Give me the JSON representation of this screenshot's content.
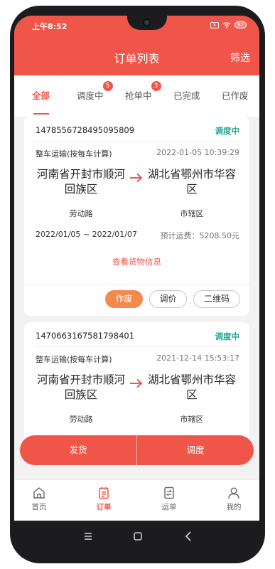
{
  "statusbar": {
    "time": "上午8:52",
    "battery": "97"
  },
  "header": {
    "title": "订单列表",
    "filter_label": "筛选"
  },
  "tabs": [
    {
      "label": "全部",
      "active": true
    },
    {
      "label": "调度中",
      "badge": "5"
    },
    {
      "label": "抢单中",
      "badge": "3"
    },
    {
      "label": "已完成"
    },
    {
      "label": "已作废"
    }
  ],
  "orders": [
    {
      "id": "1478556728495095809",
      "status": "调度中",
      "type": "整车运输(按每车计算)",
      "datetime": "2022-01-05 10:39:29",
      "from": "河南省开封市顺河回族区",
      "from_sub": "劳动路",
      "to": "湖北省鄂州市华容区",
      "to_sub": "市辖区",
      "date_range": "2022/01/05 ~ 2022/01/07",
      "fee": "预计运费：5208.50元",
      "cargo_link": "查看货物信息",
      "buttons": [
        "作废",
        "调价",
        "二维码"
      ]
    },
    {
      "id": "1470663167581798401",
      "status": "调度中",
      "type": "整车运输(按每车计算)",
      "datetime": "2021-12-14 15:53:17",
      "from": "河南省开封市顺河回族区",
      "from_sub": "劳动路",
      "to": "湖北省鄂州市华容区",
      "to_sub": "市辖区"
    }
  ],
  "action_bar": {
    "left_label": "发货",
    "right_label": "调度"
  },
  "bottom_nav": [
    {
      "label": "首页",
      "icon": "home-icon"
    },
    {
      "label": "订单",
      "icon": "order-icon",
      "active": true
    },
    {
      "label": "运单",
      "icon": "waybill-icon"
    },
    {
      "label": "我的",
      "icon": "profile-icon"
    }
  ],
  "colors": {
    "brand": "#f0554a",
    "status_green": "#2aa890",
    "button_orange": "#f38a4c"
  }
}
